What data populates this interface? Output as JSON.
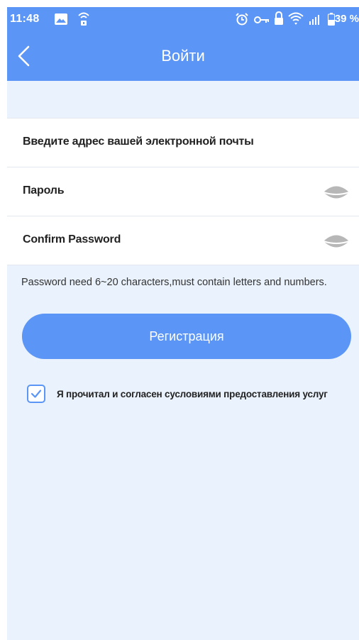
{
  "status_bar": {
    "time": "11:48",
    "battery": "39 %"
  },
  "header": {
    "title": "Войти"
  },
  "form": {
    "email_placeholder": "Введите адрес вашей электронной почты",
    "password_placeholder": "Пароль",
    "confirm_password_placeholder": "Confirm Password"
  },
  "hint": "Password need 6~20 characters,must contain letters and numbers.",
  "register_button": "Регистрация",
  "agreement": {
    "checked": true,
    "text": "Я прочитал и согласен сусловиями предоставления услуг"
  },
  "colors": {
    "accent": "#5b95f5",
    "background": "#eaf3fd"
  },
  "icons": [
    "image-icon",
    "wifi-lock-icon",
    "alarm-icon",
    "key-icon",
    "lock-icon",
    "wifi-icon",
    "signal-icon",
    "battery-icon",
    "back-arrow-icon",
    "eye-icon",
    "checkmark-icon"
  ]
}
